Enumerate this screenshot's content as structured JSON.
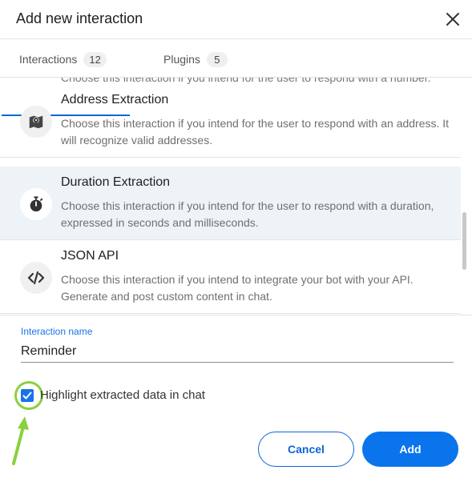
{
  "dialog": {
    "title": "Add new interaction"
  },
  "tabs": [
    {
      "label": "Interactions",
      "count": "12"
    },
    {
      "label": "Plugins",
      "count": "5"
    }
  ],
  "list": {
    "peek_text": "Choose this interaction if you intend for the user to respond with a number.",
    "items": [
      {
        "title": "Address Extraction",
        "description": "Choose this interaction if you intend for the user to respond with an address. It will recognize valid addresses.",
        "icon": "map-pin-icon",
        "selected": false
      },
      {
        "title": "Duration Extraction",
        "description": "Choose this interaction if you intend for the user to respond with a duration, expressed in seconds and milliseconds.",
        "icon": "stopwatch-icon",
        "selected": true
      },
      {
        "title": "JSON API",
        "description": "Choose this interaction if you intend to integrate your bot with your API. Generate and post custom content in chat.",
        "icon": "code-icon",
        "selected": false
      }
    ]
  },
  "form": {
    "name_label": "Interaction name",
    "name_value": "Reminder",
    "checkbox_label": "Highlight extracted data in chat",
    "checkbox_checked": true
  },
  "buttons": {
    "cancel": "Cancel",
    "add": "Add"
  },
  "colors": {
    "accent": "#0a74ec",
    "highlight_ring": "#8ccf3f"
  }
}
